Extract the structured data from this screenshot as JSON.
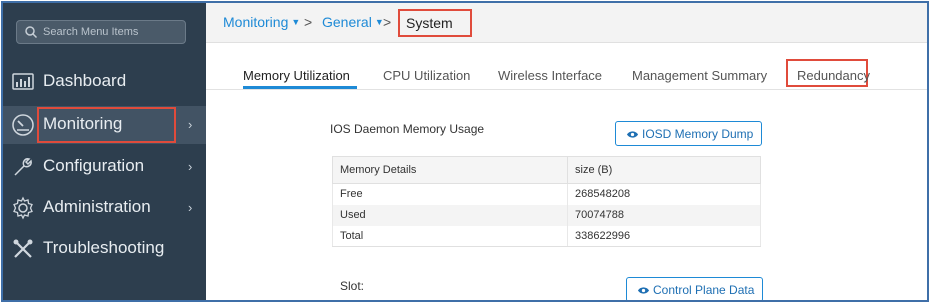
{
  "sidebar": {
    "search_placeholder": "Search Menu Items",
    "items": [
      {
        "label": "Dashboard",
        "icon": "dashboard-icon"
      },
      {
        "label": "Monitoring",
        "icon": "monitoring-icon",
        "active": true,
        "chevron": "›"
      },
      {
        "label": "Configuration",
        "icon": "configuration-icon",
        "chevron": "›"
      },
      {
        "label": "Administration",
        "icon": "administration-icon",
        "chevron": "›"
      },
      {
        "label": "Troubleshooting",
        "icon": "troubleshooting-icon"
      }
    ]
  },
  "breadcrumb": {
    "items": [
      "Monitoring",
      "General"
    ],
    "separator": ">",
    "current": "System"
  },
  "tabs": [
    {
      "label": "Memory Utilization",
      "active": true
    },
    {
      "label": "CPU Utilization"
    },
    {
      "label": "Wireless Interface"
    },
    {
      "label": "Management Summary"
    },
    {
      "label": "Redundancy"
    }
  ],
  "content": {
    "ios_daemon_label": "IOS Daemon Memory Usage",
    "iosd_button": "IOSD Memory Dump",
    "table": {
      "headers": [
        "Memory Details",
        "size (B)"
      ],
      "rows": [
        [
          "Free",
          "268548208"
        ],
        [
          "Used",
          "70074788"
        ],
        [
          "Total",
          "338622996"
        ]
      ]
    },
    "slot_label": "Slot:",
    "control_plane_button": "Control Plane Data"
  },
  "colors": {
    "sidebar_bg": "#2d3e4e",
    "accent": "#1e8ad6",
    "highlight": "#e04b3b"
  }
}
